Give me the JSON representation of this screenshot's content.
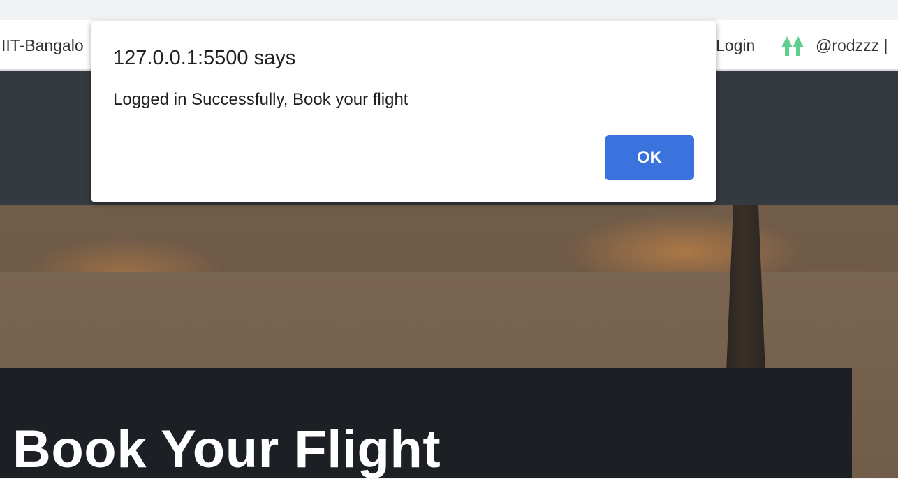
{
  "bookmarks": {
    "left_label": "IIT-Bangalo",
    "login_label": "Login",
    "user_label": "@rodzzz |",
    "icon": "twin-trees-icon",
    "icon_color": "#5fcf8f"
  },
  "page": {
    "title": "Book Your Flight",
    "nav_bg": "#343a40",
    "card_bg": "#1c1f23"
  },
  "dialog": {
    "origin": "127.0.0.1:5500 says",
    "message": "Logged in Successfully, Book your flight",
    "ok_label": "OK",
    "button_color": "#3a73de"
  }
}
